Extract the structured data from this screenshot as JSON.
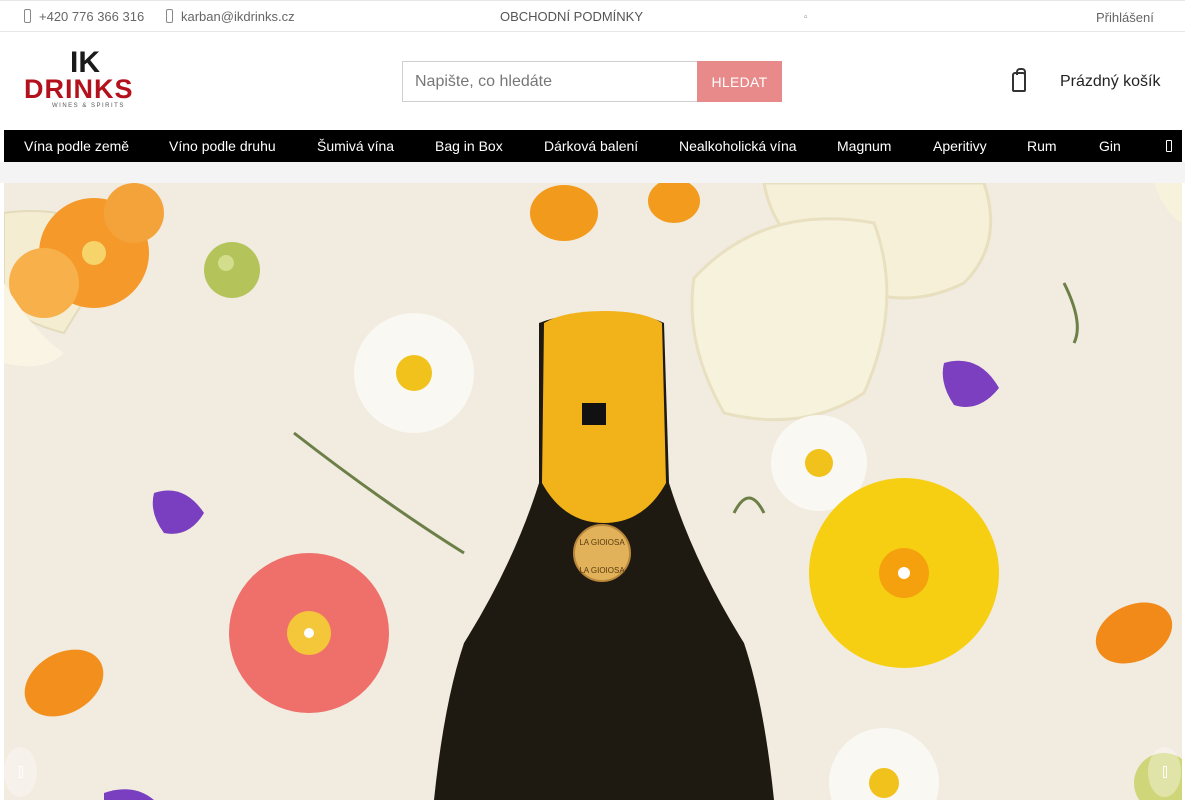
{
  "topbar": {
    "phone": "+420 776 366 316",
    "email": "karban@ikdrinks.cz",
    "terms": "OBCHODNÍ PODMÍNKY",
    "login": "Přihlášení"
  },
  "logo": {
    "line1": "IK",
    "line2": "DRINKS",
    "line3": "WINES & SPIRITS"
  },
  "search": {
    "placeholder": "Napište, co hledáte",
    "button": "HLEDAT"
  },
  "cart": {
    "label": "Prázdný košík"
  },
  "nav": {
    "items": [
      "Vína podle země",
      "Víno podle druhu",
      "Šumivá vína",
      "Bag in Box",
      "Dárková balení",
      "Nealkoholická vína",
      "Magnum",
      "Aperitivy",
      "Rum",
      "Gin"
    ]
  },
  "hero": {
    "bottle_label_top": "LA GIOIOSA",
    "bottle_label_bottom": "LA GIOIOSA"
  },
  "colors": {
    "brand_red": "#b3121d",
    "search_button": "#e88a8a",
    "nav_bg": "#000000",
    "hero_bg": "#f1ebe0"
  }
}
